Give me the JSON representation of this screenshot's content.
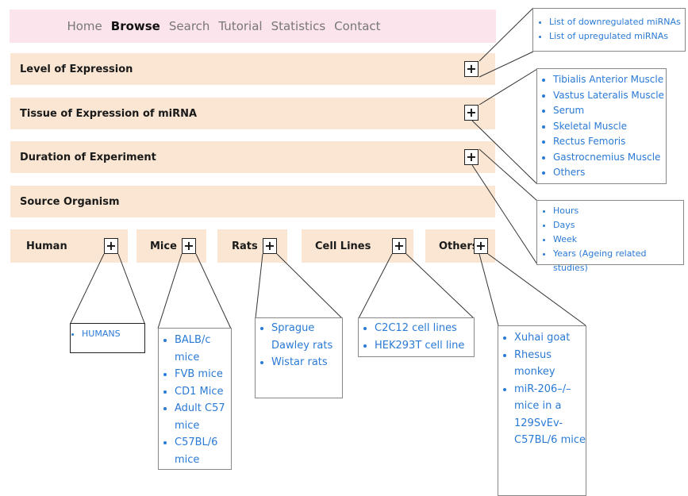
{
  "nav": {
    "items": [
      "Home",
      "Browse",
      "Search",
      "Tutorial",
      "Statistics",
      "Contact"
    ],
    "active": "Browse"
  },
  "sections": [
    {
      "label": "Level of Expression",
      "has_toggle": true
    },
    {
      "label": "Tissue of Expression of miRNA",
      "has_toggle": true
    },
    {
      "label": "Duration of Experiment",
      "has_toggle": true
    },
    {
      "label": "Source Organism",
      "has_toggle": false
    }
  ],
  "toggle_symbol": "+",
  "organisms": [
    {
      "label": "Human"
    },
    {
      "label": "Mice"
    },
    {
      "label": "Rats"
    },
    {
      "label": "Cell Lines"
    },
    {
      "label": "Others"
    }
  ],
  "popups": {
    "expression": [
      "List of downregulated miRNAs",
      "List of upregulated miRNAs"
    ],
    "tissue": [
      "Tibialis Anterior Muscle",
      "Vastus Lateralis Muscle",
      "Serum",
      "Skeletal Muscle",
      "Rectus Femoris",
      "Gastrocnemius Muscle",
      "Others"
    ],
    "duration": [
      "Hours",
      "Days",
      "Week",
      "Years (Ageing related studies)"
    ],
    "human": [
      "HUMANS"
    ],
    "mice": [
      "BALB/c mice",
      "FVB mice",
      "CD1 Mice",
      "Adult C57 mice",
      "C57BL/6 mice"
    ],
    "rats": [
      "Sprague Dawley rats",
      "Wistar rats"
    ],
    "cell_lines": [
      "C2C12 cell lines",
      "HEK293T cell line"
    ],
    "others": [
      "Xuhai goat",
      "Rhesus monkey",
      "miR-206–/– mice in a 129SvEv-C57BL/6 mice"
    ]
  },
  "colors": {
    "nav_bg": "#fce4ec",
    "bar_bg": "#fae6d2",
    "link": "#2a7ad6"
  }
}
